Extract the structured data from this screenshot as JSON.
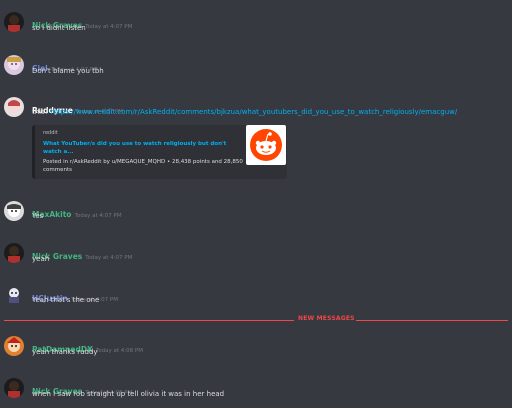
{
  "colors": {
    "background": "#36393f",
    "green": "#43b581",
    "blue": "#7289da",
    "white": "#ffffff",
    "link": "#00b0f4",
    "new_messages": "#f04747"
  },
  "messages": [
    {
      "username": "Nick Graves",
      "timestamp": "Today at 4:07 PM",
      "text": "so I didnt listen",
      "color": "#43b581"
    },
    {
      "username": "Ciel",
      "timestamp": "Today at 4:07 PM",
      "text": "Don't blame you tbh",
      "color": "#7289da"
    },
    {
      "username": "Ruddyrue",
      "timestamp": "Today at 4:07 PM",
      "text": "this?",
      "link": "https://www.reddit.com/r/AskReddit/comments/bjkzua/what_youtubers_did_you_use_to_watch_religiously/emacguw/",
      "color": "#ffffff"
    },
    {
      "username": "MaxAkito",
      "timestamp": "Today at 4:07 PM",
      "text": "Yes",
      "color": "#43b581"
    },
    {
      "username": "Nick Graves",
      "timestamp": "Today at 4:07 PM",
      "text": "yeah",
      "color": "#43b581"
    },
    {
      "username": "HCJustin",
      "timestamp": "Today at 4:07 PM",
      "text": "Yeah that's the one",
      "color": "#7289da"
    },
    {
      "username": "PatDamnedDX",
      "timestamp": "Today at 4:08 PM",
      "text": "yeah thanks ruddy",
      "color": "#43b581"
    },
    {
      "username": "Nick Graves",
      "timestamp": "Today at 4:08 PM",
      "text": "when I saw rob straight up tell olivia it was in her head",
      "color": "#43b581"
    }
  ],
  "embed": {
    "provider": "reddit",
    "title": "What YouTuber/s did you use to watch religiously but don't watch a...",
    "description": "Posted in r/AskReddit by u/MEGAQUE_MQHD • 28,438 points and 28,850 comments",
    "thumbnail_icon": "reddit-snoo-icon"
  },
  "divider": {
    "label": "NEW MESSAGES"
  }
}
